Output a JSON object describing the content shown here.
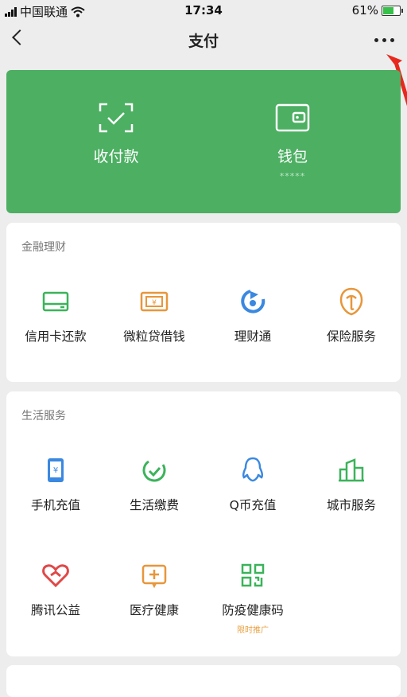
{
  "status_bar": {
    "carrier": "中国联通",
    "time": "17:34",
    "battery": "61%"
  },
  "nav": {
    "title": "支付"
  },
  "wallet_card": {
    "pay_label": "收付款",
    "wallet_label": "钱包",
    "wallet_hidden_balance": "*****"
  },
  "finance": {
    "title": "金融理财",
    "items": [
      {
        "label": "信用卡还款",
        "icon": "credit-card-icon"
      },
      {
        "label": "微粒贷借钱",
        "icon": "loan-icon"
      },
      {
        "label": "理财通",
        "icon": "wealth-icon"
      },
      {
        "label": "保险服务",
        "icon": "insurance-icon"
      }
    ]
  },
  "life": {
    "title": "生活服务",
    "items": [
      {
        "label": "手机充值",
        "icon": "phone-topup-icon"
      },
      {
        "label": "生活缴费",
        "icon": "utility-payment-icon"
      },
      {
        "label": "Q币充值",
        "icon": "qq-coin-icon"
      },
      {
        "label": "城市服务",
        "icon": "city-service-icon"
      },
      {
        "label": "腾讯公益",
        "icon": "charity-icon"
      },
      {
        "label": "医疗健康",
        "icon": "medical-icon"
      },
      {
        "label": "防疫健康码",
        "icon": "health-code-icon",
        "sub": "限时推广"
      }
    ]
  },
  "colors": {
    "wallet_green": "#4caf62",
    "icon_green": "#3bb35a",
    "icon_orange": "#e8963a",
    "icon_blue": "#3a88e0",
    "icon_red": "#e04848",
    "arrow_red": "#e8281e"
  }
}
